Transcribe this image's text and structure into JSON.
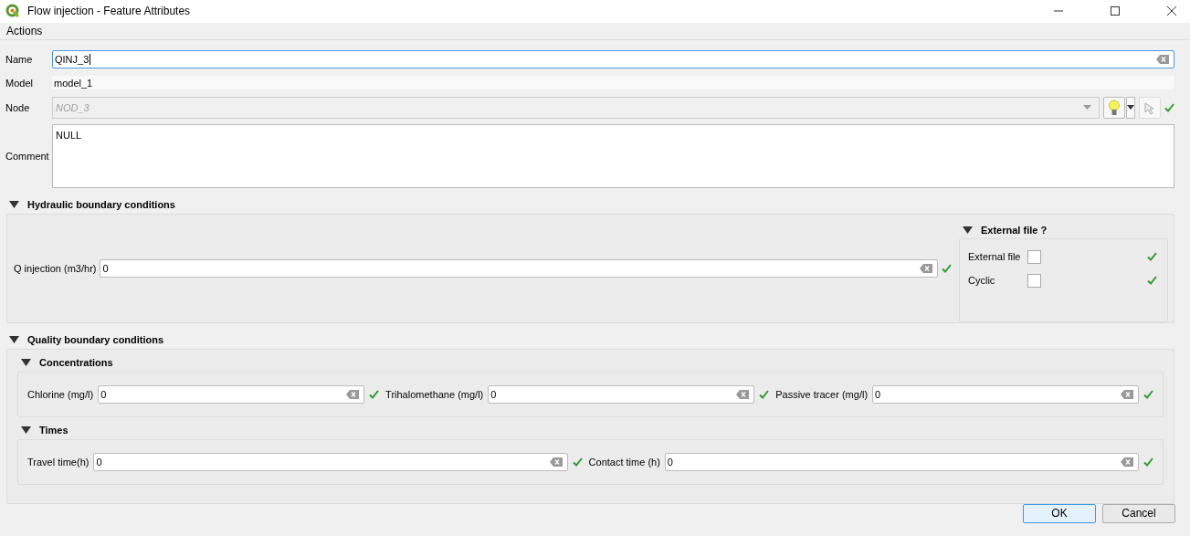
{
  "window": {
    "title": "Flow injection - Feature Attributes"
  },
  "menu": [
    "Actions"
  ],
  "fields": [
    {
      "kind": "text",
      "label": "Name",
      "value": "QINJ_3",
      "focused": true
    },
    {
      "kind": "readonly",
      "label": "Model",
      "value": "model_1"
    },
    {
      "kind": "combo",
      "label": "Node",
      "value": "NOD_3",
      "disabled": true
    },
    {
      "kind": "multiline",
      "label": "Comment",
      "value": "NULL"
    }
  ],
  "hydraulic": {
    "title": "Hydraulic boundary conditions",
    "expanded": true,
    "fields": [
      {
        "label": "Q injection (m3/hr)",
        "value": "0"
      }
    ],
    "external": {
      "title": "External file ?",
      "expanded": true,
      "checkboxes": [
        {
          "label": "External file",
          "checked": false
        },
        {
          "label": "Cyclic",
          "checked": false
        }
      ]
    }
  },
  "quality": {
    "title": "Quality boundary conditions",
    "expanded": true,
    "groups": [
      {
        "title": "Concentrations",
        "expanded": true,
        "fields": [
          {
            "label": "Chlorine (mg/l)",
            "value": "0"
          },
          {
            "label": "Trihalomethane (mg/l)",
            "value": "0"
          },
          {
            "label": "Passive tracer (mg/l)",
            "value": "0"
          }
        ]
      },
      {
        "title": "Times",
        "expanded": true,
        "fields": [
          {
            "label": "Travel time(h)",
            "value": "0"
          },
          {
            "label": "Contact time (h)",
            "value": "0"
          }
        ]
      }
    ]
  },
  "buttons": [
    {
      "label": "OK",
      "default": true
    },
    {
      "label": "Cancel",
      "default": false
    }
  ]
}
